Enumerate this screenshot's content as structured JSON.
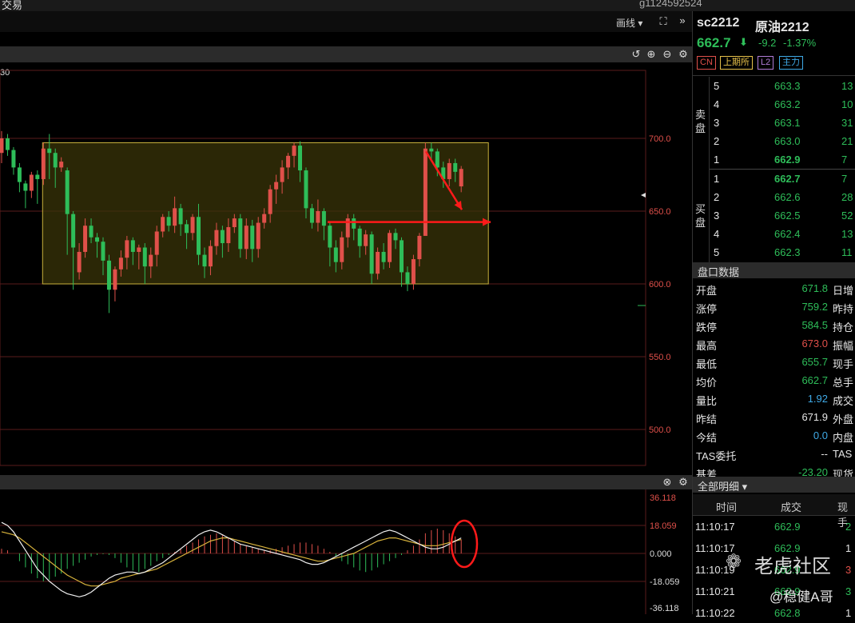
{
  "topbar": {
    "left_text": "交易",
    "user_text": "g1124592524"
  },
  "chart_toolbar": {
    "draw_label": "画线 ▾",
    "expand_icon": "expand-icon",
    "more_icon": "chevron-right-icon"
  },
  "chart_header": {
    "timeframe_fragment": "30"
  },
  "main_axis": {
    "labels": [
      "700.0",
      "650.0",
      "600.0",
      "550.0",
      "500.0"
    ]
  },
  "indicator_axis": {
    "labels": [
      "36.118",
      "18.059",
      "0.000",
      "-18.059",
      "-36.118"
    ]
  },
  "quote": {
    "symbol": "sc2212",
    "name": "原油2212",
    "last": "662.7",
    "change": "-9.2",
    "change_pct": "-1.37%",
    "tags": [
      "CN",
      "上期所",
      "L2",
      "主力"
    ]
  },
  "order_book": {
    "ask_label": "卖盘",
    "bid_label": "买盘",
    "asks": [
      {
        "level": "5",
        "price": "663.3",
        "vol": "13"
      },
      {
        "level": "4",
        "price": "663.2",
        "vol": "10"
      },
      {
        "level": "3",
        "price": "663.1",
        "vol": "31"
      },
      {
        "level": "2",
        "price": "663.0",
        "vol": "21"
      },
      {
        "level": "1",
        "price": "662.9",
        "vol": "7"
      }
    ],
    "bids": [
      {
        "level": "1",
        "price": "662.7",
        "vol": "7"
      },
      {
        "level": "2",
        "price": "662.6",
        "vol": "28"
      },
      {
        "level": "3",
        "price": "662.5",
        "vol": "52"
      },
      {
        "level": "4",
        "price": "662.4",
        "vol": "13"
      },
      {
        "level": "5",
        "price": "662.3",
        "vol": "11"
      }
    ]
  },
  "panel_data": {
    "title": "盘口数据",
    "rows": [
      {
        "label": "开盘",
        "value": "671.8",
        "right": "日增"
      },
      {
        "label": "涨停",
        "value": "759.2",
        "right": "昨持"
      },
      {
        "label": "跌停",
        "value": "584.5",
        "right": "持仓"
      },
      {
        "label": "最高",
        "value": "673.0",
        "right": "振幅"
      },
      {
        "label": "最低",
        "value": "655.7",
        "right": "现手"
      },
      {
        "label": "均价",
        "value": "662.7",
        "right": "总手"
      },
      {
        "label": "量比",
        "value": "1.92",
        "right": "成交"
      },
      {
        "label": "昨结",
        "value": "671.9",
        "right": "外盘"
      },
      {
        "label": "今结",
        "value": "0.0",
        "right": "内盘"
      },
      {
        "label": "TAS委托",
        "value": "--",
        "right": "TAS"
      },
      {
        "label": "基差",
        "value": "-23.20",
        "right": "现货"
      }
    ]
  },
  "trades": {
    "title": "全部明细 ▾",
    "headers": [
      "时间",
      "成交",
      "现手"
    ],
    "rows": [
      {
        "time": "11:10:17",
        "price": "662.9",
        "qty": "2"
      },
      {
        "time": "11:10:17",
        "price": "662.9",
        "qty": "1"
      },
      {
        "time": "11:10:19",
        "price": "662.9",
        "qty": "3"
      },
      {
        "time": "11:10:21",
        "price": "662.9",
        "qty": "3"
      },
      {
        "time": "11:10:22",
        "price": "662.8",
        "qty": "1"
      }
    ]
  },
  "watermark": {
    "brand": "老虎社区",
    "author": "@稳健A哥"
  },
  "colors": {
    "up": "#e0504a",
    "down": "#2ebd59",
    "box": "#c9b23c",
    "arrow": "#ff1a1a"
  },
  "chart_data": {
    "type": "candlestick",
    "ylim": [
      480,
      722
    ],
    "y_ticks": [
      700,
      650,
      600,
      550,
      500
    ],
    "box_range": [
      600,
      697
    ],
    "candles": [
      [
        690,
        700,
        684,
        705,
        683
      ],
      [
        700,
        692,
        688,
        703,
        689
      ],
      [
        692,
        680,
        677,
        694,
        675
      ],
      [
        680,
        670,
        668,
        683,
        663
      ],
      [
        669,
        664,
        655,
        671,
        652
      ],
      [
        664,
        675,
        660,
        677,
        659
      ],
      [
        675,
        672,
        658,
        678,
        655
      ],
      [
        672,
        693,
        670,
        697,
        668
      ],
      [
        693,
        690,
        675,
        703,
        672
      ],
      [
        690,
        680,
        668,
        693,
        666
      ],
      [
        680,
        684,
        678,
        687,
        677
      ],
      [
        678,
        648,
        628,
        680,
        620
      ],
      [
        648,
        625,
        603,
        650,
        596
      ],
      [
        608,
        622,
        607,
        628,
        603
      ],
      [
        622,
        640,
        620,
        645,
        618
      ],
      [
        640,
        632,
        628,
        645,
        628
      ],
      [
        632,
        629,
        620,
        635,
        618
      ],
      [
        629,
        616,
        608,
        632,
        606
      ],
      [
        616,
        596,
        592,
        620,
        580
      ],
      [
        596,
        610,
        594,
        612,
        588
      ],
      [
        610,
        618,
        606,
        623,
        605
      ],
      [
        618,
        630,
        612,
        633,
        610
      ],
      [
        630,
        622,
        616,
        632,
        613
      ],
      [
        622,
        625,
        614,
        627,
        610
      ],
      [
        625,
        612,
        605,
        628,
        600
      ],
      [
        612,
        620,
        606,
        625,
        604
      ],
      [
        620,
        636,
        615,
        640,
        612
      ],
      [
        636,
        646,
        634,
        648,
        632
      ],
      [
        646,
        640,
        638,
        650,
        636
      ],
      [
        640,
        652,
        638,
        660,
        635
      ],
      [
        652,
        641,
        634,
        655,
        633
      ],
      [
        641,
        635,
        628,
        644,
        624
      ],
      [
        635,
        646,
        632,
        648,
        630
      ],
      [
        646,
        620,
        615,
        655,
        613
      ],
      [
        620,
        612,
        607,
        625,
        604
      ],
      [
        612,
        626,
        608,
        630,
        606
      ],
      [
        626,
        637,
        622,
        642,
        620
      ],
      [
        637,
        628,
        622,
        640,
        618
      ],
      [
        628,
        639,
        625,
        645,
        622
      ],
      [
        639,
        645,
        637,
        648,
        635
      ],
      [
        645,
        624,
        620,
        648,
        618
      ],
      [
        624,
        640,
        620,
        645,
        617
      ],
      [
        640,
        624,
        619,
        644,
        615
      ],
      [
        624,
        642,
        620,
        646,
        618
      ],
      [
        642,
        648,
        640,
        652,
        638
      ],
      [
        648,
        665,
        644,
        668,
        642
      ],
      [
        665,
        670,
        658,
        675,
        655
      ],
      [
        670,
        680,
        665,
        685,
        662
      ],
      [
        680,
        688,
        675,
        690,
        672
      ],
      [
        688,
        695,
        685,
        697,
        680
      ],
      [
        695,
        678,
        673,
        698,
        670
      ],
      [
        678,
        652,
        648,
        680,
        645
      ],
      [
        652,
        642,
        640,
        655,
        638
      ],
      [
        642,
        650,
        642,
        658,
        636
      ],
      [
        650,
        640,
        634,
        652,
        630
      ],
      [
        640,
        625,
        615,
        643,
        612
      ],
      [
        625,
        615,
        612,
        630,
        608
      ],
      [
        615,
        632,
        612,
        636,
        610
      ],
      [
        632,
        645,
        628,
        648,
        625
      ],
      [
        645,
        638,
        632,
        648,
        630
      ],
      [
        638,
        626,
        620,
        640,
        618
      ],
      [
        626,
        634,
        622,
        637,
        620
      ],
      [
        634,
        607,
        602,
        636,
        600
      ],
      [
        607,
        622,
        604,
        625,
        603
      ],
      [
        622,
        615,
        612,
        628,
        610
      ],
      [
        615,
        635,
        613,
        637,
        611
      ],
      [
        635,
        630,
        626,
        638,
        624
      ],
      [
        630,
        608,
        600,
        632,
        598
      ],
      [
        608,
        600,
        596,
        612,
        595
      ],
      [
        600,
        617,
        598,
        620,
        596
      ],
      [
        617,
        633,
        615,
        635,
        612
      ],
      [
        633,
        693,
        691,
        697,
        689
      ],
      [
        693,
        691,
        686,
        697,
        685
      ],
      [
        691,
        680,
        676,
        693,
        674
      ],
      [
        680,
        672,
        668,
        684,
        666
      ],
      [
        672,
        683,
        670,
        686,
        667
      ],
      [
        683,
        677,
        672,
        686,
        670
      ],
      [
        667,
        679,
        665,
        681,
        663
      ]
    ],
    "annotations": [
      {
        "type": "box",
        "x_range": [
          "bar7",
          "bar75"
        ],
        "y_range": [
          600,
          697
        ]
      },
      {
        "type": "arrow",
        "from": [
          691,
          "bar71"
        ],
        "to": [
          651,
          "bar75"
        ]
      },
      {
        "type": "arrow",
        "from": [
          640,
          "bar50"
        ],
        "to": [
          640,
          "bar75"
        ]
      }
    ],
    "macd": {
      "ylim": [
        -36.118,
        36.118
      ],
      "ticks": [
        36.118,
        18.059,
        0,
        -18.059,
        -36.118
      ],
      "hist": [
        3,
        2,
        0,
        -5,
        -9,
        -13,
        -16,
        -18,
        -17,
        -15,
        -13,
        -10,
        -8,
        -6,
        -4,
        -2,
        -1,
        -0.5,
        -1,
        -3,
        -6,
        -9,
        -11,
        -12,
        -10,
        -8,
        -5,
        -3,
        -1,
        1,
        3,
        5,
        7,
        9,
        11,
        12,
        13,
        12,
        10,
        8,
        6,
        5,
        4,
        3,
        2,
        2,
        3,
        4,
        5,
        6,
        7,
        7,
        6,
        5,
        3,
        1,
        -2,
        -5,
        -7,
        -9,
        -11,
        -12,
        -11,
        -9,
        -7,
        -5,
        -3,
        -1,
        2,
        5,
        9,
        13,
        15,
        16,
        15,
        13,
        11,
        9
      ],
      "dif": [
        20,
        18,
        14,
        8,
        2,
        -4,
        -10,
        -14,
        -18,
        -21,
        -24,
        -26,
        -27,
        -28,
        -27,
        -25,
        -22,
        -19,
        -16,
        -14,
        -13,
        -12,
        -12,
        -13,
        -12,
        -10,
        -8,
        -6,
        -3,
        0,
        3,
        6,
        9,
        12,
        14,
        15,
        14,
        12,
        10,
        8,
        6,
        5,
        4,
        3,
        2,
        1,
        0,
        -1,
        -2,
        -3,
        -4,
        -6,
        -7,
        -7,
        -6,
        -4,
        -2,
        0,
        2,
        4,
        6,
        8,
        10,
        12,
        14,
        15,
        14,
        12,
        10,
        8,
        6,
        4,
        3,
        3,
        4,
        6,
        8,
        10
      ],
      "dea": [
        14,
        13,
        12,
        10,
        7,
        4,
        1,
        -2,
        -5,
        -8,
        -11,
        -14,
        -16,
        -18,
        -20,
        -21,
        -21,
        -20,
        -19,
        -18,
        -16,
        -15,
        -14,
        -13,
        -12,
        -11,
        -10,
        -8,
        -6,
        -4,
        -2,
        0,
        2,
        4,
        6,
        8,
        9,
        10,
        10,
        9,
        8,
        7,
        6,
        5,
        4,
        3,
        2,
        1,
        0,
        -1,
        -2,
        -3,
        -4,
        -5,
        -5,
        -4,
        -3,
        -2,
        -1,
        0,
        2,
        4,
        6,
        8,
        9,
        10,
        10,
        9,
        8,
        7,
        6,
        5,
        5,
        5,
        6,
        7,
        8,
        9
      ]
    }
  }
}
